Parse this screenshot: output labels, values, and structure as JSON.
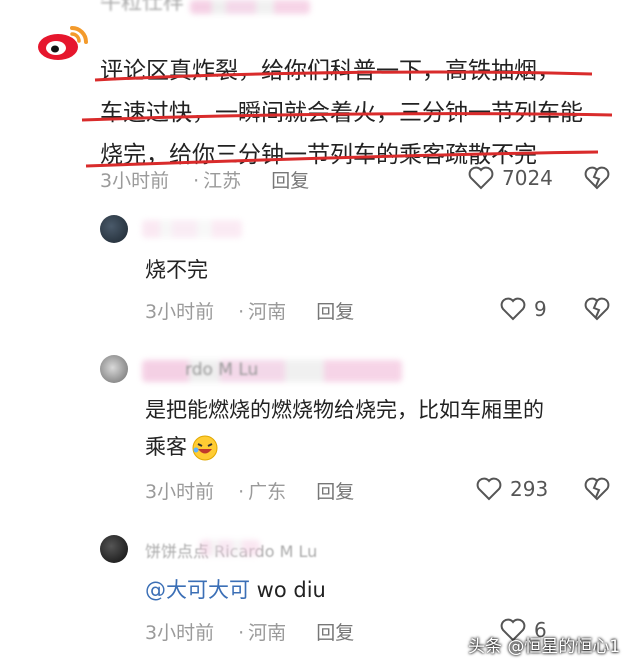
{
  "comment_main": {
    "username": "牛粒仕样",
    "text_lines": [
      "评论区真炸裂，给你们科普一下，高铁抽烟，",
      "车速过快，一瞬间就会着火，三分钟一节列车能",
      "烧完，给你三分钟一节列车的乘客疏散不完"
    ],
    "time": "3小时前",
    "location": "江苏",
    "reply_label": "回复",
    "likes": "7024"
  },
  "replies": [
    {
      "text_lines": [
        "烧不完"
      ],
      "time": "3小时前",
      "location": "河南",
      "reply_label": "回复",
      "likes": "9"
    },
    {
      "username": "rdo M Lu",
      "text_lines": [
        "是把能燃烧的燃烧物给烧完，比如车厢里的",
        "乘客"
      ],
      "time": "3小时前",
      "location": "广东",
      "reply_label": "回复",
      "likes": "293"
    },
    {
      "username": "饼饼点点 Ricardo M Lu",
      "mention": "@大可大可",
      "text": " wo diu",
      "time": "3小时前",
      "location": "河南",
      "reply_label": "回复",
      "likes": "6"
    }
  ],
  "watermark": "头条 @恒星的恒心1",
  "colors": {
    "red_underline": "#d92b2b",
    "meta_gray": "#9a9a9a",
    "mention_blue": "#3b6fb6"
  }
}
